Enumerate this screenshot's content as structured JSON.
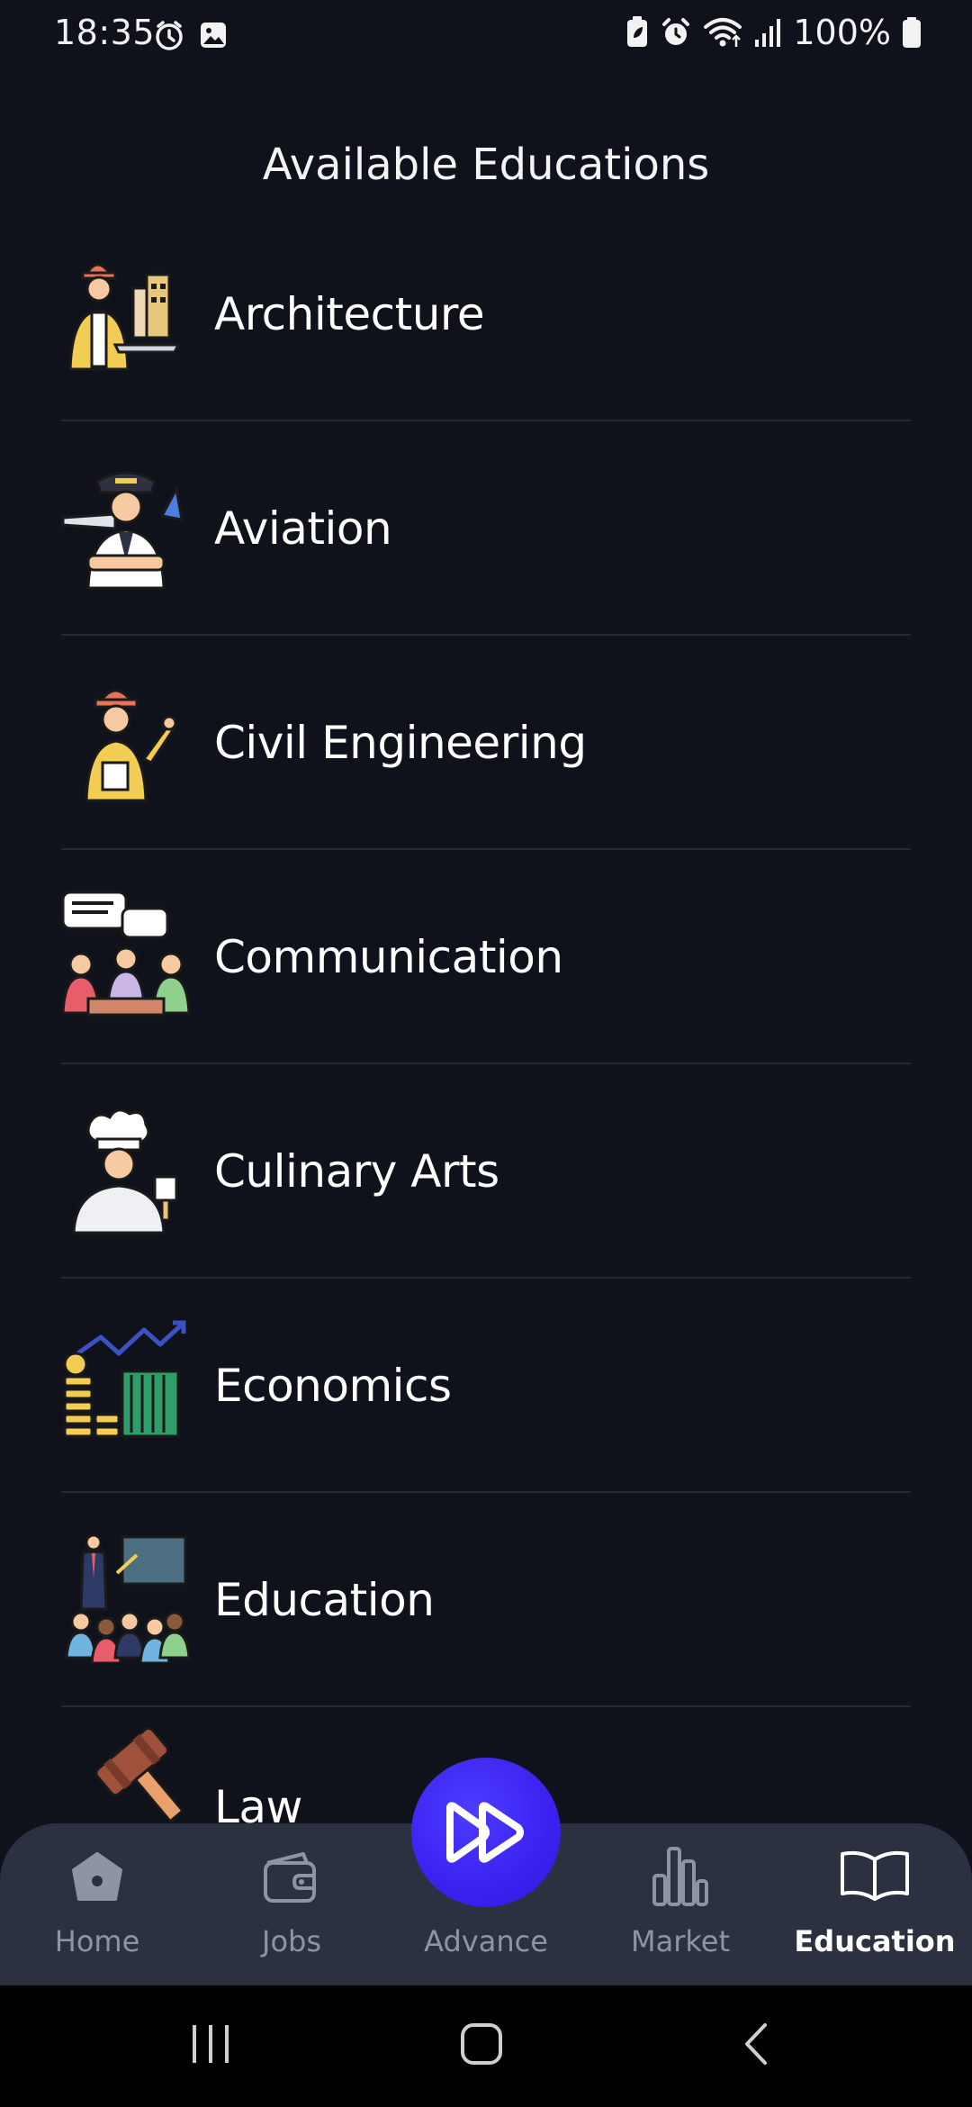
{
  "status_bar": {
    "time": "18:35",
    "battery": "100%",
    "icons": [
      "clock-badge-icon",
      "image-icon",
      "battery-saver-icon",
      "alarm-icon",
      "wifi-icon",
      "signal-icon",
      "battery-icon"
    ]
  },
  "page": {
    "title": "Available Educations"
  },
  "educations": [
    {
      "label": "Architecture",
      "icon": "architect-icon"
    },
    {
      "label": "Aviation",
      "icon": "pilot-icon"
    },
    {
      "label": "Civil Engineering",
      "icon": "engineer-icon"
    },
    {
      "label": "Communication",
      "icon": "chat-group-icon"
    },
    {
      "label": "Culinary Arts",
      "icon": "chef-icon"
    },
    {
      "label": "Economics",
      "icon": "economy-chart-icon"
    },
    {
      "label": "Education",
      "icon": "teacher-icon"
    },
    {
      "label": "Law",
      "icon": "gavel-icon"
    }
  ],
  "bottom_nav": {
    "items": [
      {
        "label": "Home",
        "icon": "home-icon",
        "active": false
      },
      {
        "label": "Jobs",
        "icon": "wallet-icon",
        "active": false
      },
      {
        "label": "Advance",
        "icon": "fast-forward-icon",
        "active": false
      },
      {
        "label": "Market",
        "icon": "bar-chart-icon",
        "active": false
      },
      {
        "label": "Education",
        "icon": "book-icon",
        "active": true
      }
    ]
  },
  "colors": {
    "background": "#10121b",
    "nav_background": "#2c3142",
    "fab": "#3b22f0",
    "inactive": "#8f94a3",
    "active": "#ffffff"
  }
}
